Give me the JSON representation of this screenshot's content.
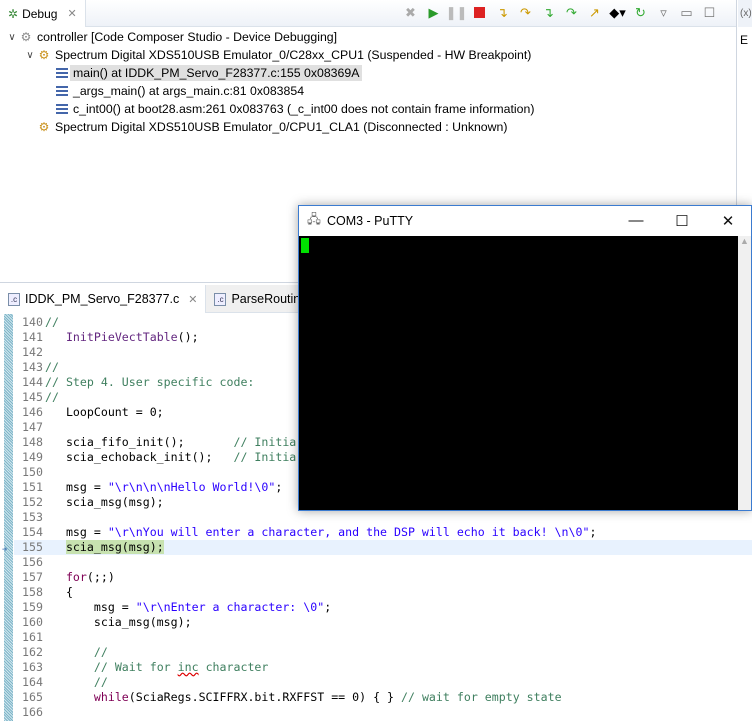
{
  "debug": {
    "tab": "Debug",
    "tree": [
      {
        "level": 0,
        "label": "controller [Code Composer Studio - Device Debugging]",
        "icon": "target-icon",
        "twisty": "∨"
      },
      {
        "level": 1,
        "label": "Spectrum Digital XDS510USB Emulator_0/C28xx_CPU1 (Suspended - HW Breakpoint)",
        "icon": "suspended-thread-icon",
        "twisty": "∨"
      },
      {
        "level": 2,
        "label": "main() at IDDK_PM_Servo_F28377.c:155 0x08369A",
        "icon": "stack-frame-icon",
        "selected": true
      },
      {
        "level": 2,
        "label": "_args_main() at args_main.c:81 0x083854",
        "icon": "stack-frame-icon"
      },
      {
        "level": 2,
        "label": "c_int00() at boot28.asm:261 0x083763  (_c_int00 does not contain frame information)",
        "icon": "stack-frame-icon"
      },
      {
        "level": 1,
        "label": "Spectrum Digital XDS510USB Emulator_0/CPU1_CLA1 (Disconnected : Unknown)",
        "icon": "disconnected-thread-icon"
      }
    ]
  },
  "right_panel": {
    "tab": "(x)",
    "label": "E"
  },
  "editor": {
    "tabs": [
      {
        "label": "IDDK_PM_Servo_F28377.c",
        "active": true
      },
      {
        "label": "ParseRoutine.c"
      }
    ],
    "current_line": "155",
    "lines": [
      {
        "n": "140",
        "s": [
          [
            "cm",
            "//"
          ]
        ]
      },
      {
        "n": "141",
        "s": [
          [
            "",
            "   "
          ],
          [
            "fn",
            "InitPieVectTable"
          ],
          [
            "",
            "();"
          ]
        ]
      },
      {
        "n": "142",
        "s": []
      },
      {
        "n": "143",
        "s": [
          [
            "cm",
            "//"
          ]
        ]
      },
      {
        "n": "144",
        "s": [
          [
            "cm",
            "// Step 4. User specific code:"
          ]
        ]
      },
      {
        "n": "145",
        "s": [
          [
            "cm",
            "//"
          ]
        ]
      },
      {
        "n": "146",
        "s": [
          [
            "",
            "   LoopCount = 0;"
          ]
        ]
      },
      {
        "n": "147",
        "s": []
      },
      {
        "n": "148",
        "s": [
          [
            "",
            "   scia_fifo_init();       "
          ],
          [
            "cm",
            "// Initia"
          ]
        ]
      },
      {
        "n": "149",
        "s": [
          [
            "",
            "   scia_echoback_init();   "
          ],
          [
            "cm",
            "// Initia"
          ]
        ]
      },
      {
        "n": "150",
        "s": []
      },
      {
        "n": "151",
        "s": [
          [
            "",
            "   msg = "
          ],
          [
            "str",
            "\"\\r\\n\\n\\nHello World!\\0\""
          ],
          [
            "",
            ";"
          ]
        ]
      },
      {
        "n": "152",
        "s": [
          [
            "",
            "   scia_msg(msg);"
          ]
        ]
      },
      {
        "n": "153",
        "s": []
      },
      {
        "n": "154",
        "s": [
          [
            "",
            "   msg = "
          ],
          [
            "str",
            "\"\\r\\nYou will enter a character, and the DSP will echo it back! \\n\\0\""
          ],
          [
            "",
            ";"
          ]
        ]
      },
      {
        "n": "155",
        "s": [
          [
            "",
            "   "
          ],
          [
            "hl",
            "scia_msg(msg);"
          ]
        ]
      },
      {
        "n": "156",
        "s": []
      },
      {
        "n": "157",
        "s": [
          [
            "",
            "   "
          ],
          [
            "kw",
            "for"
          ],
          [
            "",
            "(;;)"
          ]
        ]
      },
      {
        "n": "158",
        "s": [
          [
            "",
            "   {"
          ]
        ]
      },
      {
        "n": "159",
        "s": [
          [
            "",
            "       msg = "
          ],
          [
            "str",
            "\"\\r\\nEnter a character: \\0\""
          ],
          [
            "",
            ";"
          ]
        ]
      },
      {
        "n": "160",
        "s": [
          [
            "",
            "       scia_msg(msg);"
          ]
        ]
      },
      {
        "n": "161",
        "s": []
      },
      {
        "n": "162",
        "s": [
          [
            "",
            "       "
          ],
          [
            "cm",
            "//"
          ]
        ]
      },
      {
        "n": "163",
        "s": [
          [
            "",
            "       "
          ],
          [
            "cm",
            "// Wait for "
          ],
          [
            "cm sq",
            "inc"
          ],
          [
            "cm",
            " character"
          ]
        ]
      },
      {
        "n": "164",
        "s": [
          [
            "",
            "       "
          ],
          [
            "cm",
            "//"
          ]
        ]
      },
      {
        "n": "165",
        "s": [
          [
            "",
            "       "
          ],
          [
            "kw",
            "while"
          ],
          [
            "",
            "(SciaRegs.SCIFFRX.bit.RXFFST == 0) { } "
          ],
          [
            "cm",
            "// wait for empty state"
          ]
        ]
      },
      {
        "n": "166",
        "s": []
      }
    ]
  },
  "putty": {
    "title": "COM3 - PuTTY",
    "minimize": "—",
    "maximize": "☐",
    "close": "✕"
  }
}
